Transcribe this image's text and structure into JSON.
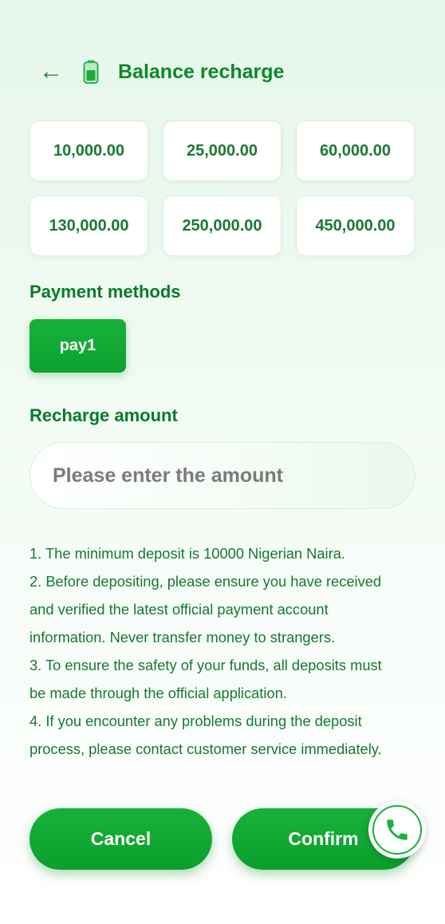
{
  "header": {
    "title": "Balance recharge",
    "back_icon": "arrow-left-icon",
    "title_icon": "battery-icon"
  },
  "amounts": [
    "10,000.00",
    "25,000.00",
    "60,000.00",
    "130,000.00",
    "250,000.00",
    "450,000.00"
  ],
  "payment": {
    "label": "Payment methods",
    "methods": [
      "pay1"
    ],
    "selected": "pay1"
  },
  "recharge": {
    "label": "Recharge amount",
    "placeholder": "Please enter the amount",
    "value": ""
  },
  "notes": [
    "1. The minimum deposit is 10000 Nigerian Naira.",
    "2. Before depositing, please ensure you have received",
    "and verified the latest official payment account",
    "information. Never transfer money to strangers.",
    "3. To ensure the safety of your funds, all deposits must",
    "be made through the official application.",
    "4. If you encounter any problems during the deposit",
    "process, please contact customer service immediately."
  ],
  "actions": {
    "cancel": "Cancel",
    "confirm": "Confirm"
  },
  "support_icon": "phone-icon",
  "colors": {
    "primary": "#12a935",
    "text_green": "#0a8a2a",
    "background": "#e6f6ea"
  }
}
